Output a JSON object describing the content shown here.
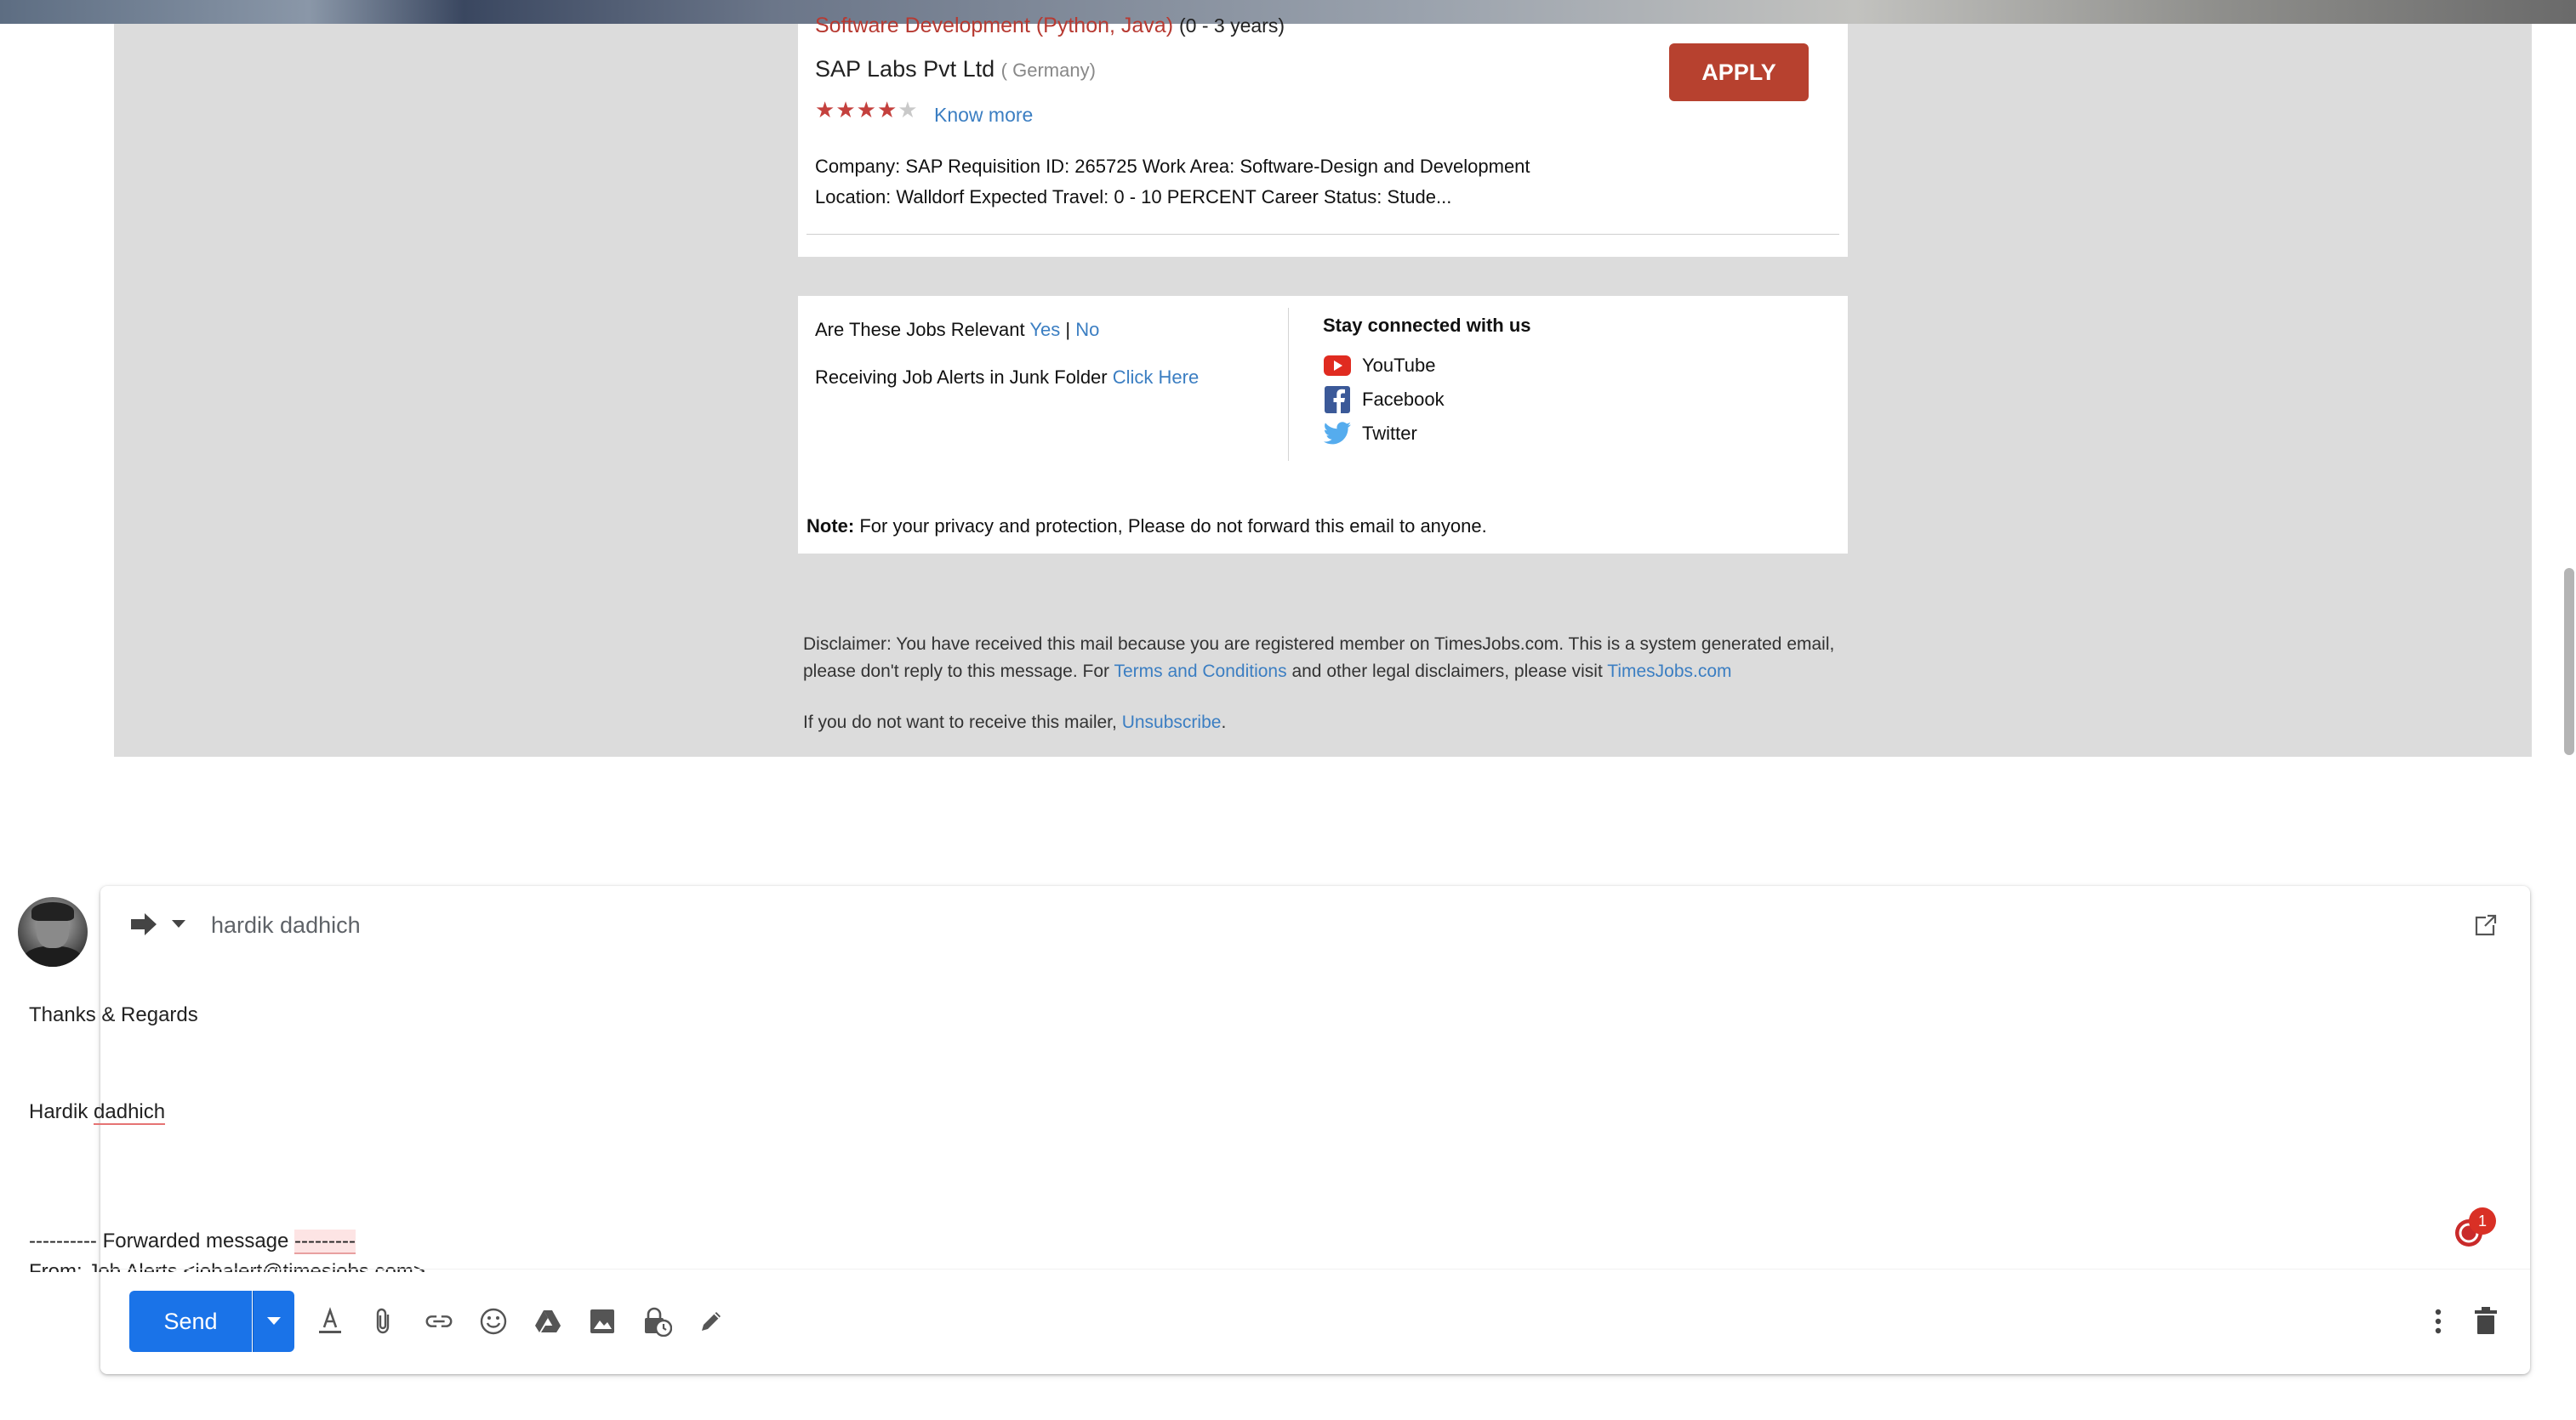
{
  "email": {
    "job": {
      "title": "Software Development (Python, Java)",
      "experience": "(0 - 3 years)",
      "company": "SAP Labs Pvt Ltd",
      "location": "( Germany)",
      "rating_stars": 4,
      "rating_max": 5,
      "know_more": "Know more",
      "apply_label": "APPLY",
      "description_line1": "Company: SAP Requisition ID: 265725 Work Area: Software-Design and Development",
      "description_line2": "Location: Walldorf Expected Travel: 0 - 10 PERCENT Career Status: Stude..."
    },
    "relevance": {
      "question": "Are These Jobs Relevant",
      "yes": "Yes",
      "separator": "|",
      "no": "No",
      "junk_text": "Receiving Job Alerts in Junk Folder",
      "junk_link": "Click Here"
    },
    "social": {
      "title": "Stay connected with us",
      "youtube": "YouTube",
      "facebook": "Facebook",
      "twitter": "Twitter"
    },
    "note": {
      "label": "Note:",
      "text": "For your privacy and protection, Please do not forward this email to anyone."
    },
    "disclaimer": {
      "text_before": "Disclaimer: You have received this mail because you are registered member on TimesJobs.com. This is a system generated email, please don't reply to this message. For",
      "terms_link": "Terms and Conditions",
      "text_middle": "and other legal disclaimers, please visit",
      "site_link": "TimesJobs.com"
    },
    "unsubscribe": {
      "text": "If you do not want to receive this mailer,",
      "link": "Unsubscribe",
      "suffix": "."
    }
  },
  "compose": {
    "recipient": "hardik dadhich",
    "body_line1": "Thanks & Regards",
    "body_signature_first": "Hardik",
    "body_signature_last": "dadhich",
    "forwarded_dashes": "----------",
    "forwarded_label": "Forwarded message",
    "forwarded_dashes_end": "---------",
    "from_partial": "From: Job Alerts <jobalert@timesjobs.com>",
    "badge_count": "1",
    "send_label": "Send"
  },
  "colors": {
    "accent": "#1a73e8",
    "apply": "#b7412f",
    "link": "#3b7ec2",
    "job_title": "#b73a32"
  }
}
